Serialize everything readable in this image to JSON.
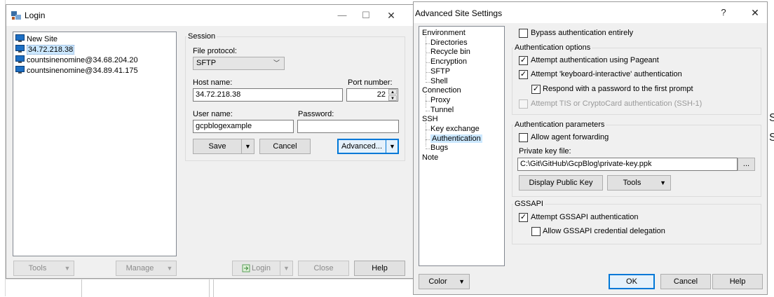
{
  "login": {
    "title": "Login",
    "sites": [
      {
        "label": "New Site"
      },
      {
        "label": "34.72.218.38"
      },
      {
        "label": "countsinenomine@34.68.204.20"
      },
      {
        "label": "countsinenomine@34.89.41.175"
      }
    ],
    "session": {
      "group_label": "Session",
      "file_protocol_label": "File protocol:",
      "file_protocol_value": "SFTP",
      "host_label": "Host name:",
      "host_value": "34.72.218.38",
      "port_label": "Port number:",
      "port_value": "22",
      "user_label": "User name:",
      "user_value": "gcpblogexample",
      "password_label": "Password:",
      "password_value": ""
    },
    "buttons": {
      "save": "Save",
      "cancel": "Cancel",
      "advanced": "Advanced...",
      "tools": "Tools",
      "manage": "Manage",
      "login": "Login",
      "close": "Close",
      "help": "Help"
    }
  },
  "advanced": {
    "title": "Advanced Site Settings",
    "help_glyph": "?",
    "close_glyph": "✕",
    "tree": [
      {
        "label": "Environment",
        "level": 0
      },
      {
        "label": "Directories",
        "level": 1
      },
      {
        "label": "Recycle bin",
        "level": 1
      },
      {
        "label": "Encryption",
        "level": 1
      },
      {
        "label": "SFTP",
        "level": 1
      },
      {
        "label": "Shell",
        "level": 1
      },
      {
        "label": "Connection",
        "level": 0
      },
      {
        "label": "Proxy",
        "level": 1
      },
      {
        "label": "Tunnel",
        "level": 1
      },
      {
        "label": "SSH",
        "level": 0
      },
      {
        "label": "Key exchange",
        "level": 1
      },
      {
        "label": "Authentication",
        "level": 1,
        "selected": true
      },
      {
        "label": "Bugs",
        "level": 1
      },
      {
        "label": "Note",
        "level": 0
      }
    ],
    "bypass": {
      "label": "Bypass authentication entirely",
      "checked": false
    },
    "auth_options": {
      "title": "Authentication options",
      "pageant": {
        "label": "Attempt authentication using Pageant",
        "checked": true
      },
      "keyboard": {
        "label": "Attempt 'keyboard-interactive' authentication",
        "checked": true
      },
      "respond": {
        "label": "Respond with a password to the first prompt",
        "checked": true
      },
      "tis": {
        "label": "Attempt TIS or CryptoCard authentication (SSH-1)",
        "checked": false,
        "disabled": true
      }
    },
    "auth_params": {
      "title": "Authentication parameters",
      "agent_forwarding": {
        "label": "Allow agent forwarding",
        "checked": false
      },
      "private_key_label": "Private key file:",
      "private_key_value": "C:\\Git\\GitHub\\GcpBlog\\private-key.ppk",
      "browse": "...",
      "display_public_key": "Display Public Key",
      "tools": "Tools"
    },
    "gssapi": {
      "title": "GSSAPI",
      "attempt": {
        "label": "Attempt GSSAPI authentication",
        "checked": true
      },
      "delegation": {
        "label": "Allow GSSAPI credential delegation",
        "checked": false
      }
    },
    "buttons": {
      "color": "Color",
      "ok": "OK",
      "cancel": "Cancel",
      "help": "Help"
    }
  },
  "colors": {
    "accent": "#0078d7",
    "selection": "#cce8ff"
  },
  "icons": {
    "check": "✓",
    "dropdown": "▼",
    "spin_up": "▲",
    "spin_down": "▼"
  }
}
